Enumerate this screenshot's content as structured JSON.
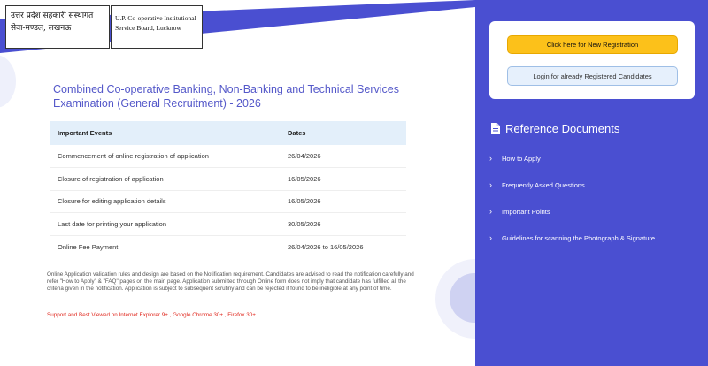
{
  "header": {
    "logo_hindi_line1": "उत्तर प्रदेश सहकारी संस्थागत",
    "logo_hindi_line2": "सेवा-मण्डल, लखनऊ",
    "logo_english_line1": "U.P. Co-operative Institutional",
    "logo_english_line2": "Service Board, Lucknow"
  },
  "main": {
    "title": "Combined Co-operative Banking, Non-Banking and Technical Services Examination (General Recruitment) - 2026",
    "table": {
      "headers": [
        "Important Events",
        "Dates"
      ],
      "rows": [
        [
          "Commencement of online registration of application",
          "26/04/2026"
        ],
        [
          "Closure of registration of application",
          "16/05/2026"
        ],
        [
          "Closure for editing application details",
          "16/05/2026"
        ],
        [
          "Last date for printing your application",
          "30/05/2026"
        ],
        [
          "Online Fee Payment",
          "26/04/2026 to 16/05/2026"
        ]
      ]
    },
    "notice": "Online Application validation rules and design are based on the Notification requirement. Candidates are advised to read the notification carefully and refer \"How to Apply\" & \"FAQ\" pages on the main page. Application submitted through Online form does not imply that candidate has fulfilled all the criteria given in the notification. Application is subject to subsequent scrutiny and can be rejected if found to be ineligible at any point of time.",
    "support": "Support and Best Viewed on Internet Explorer 9+ , Google Chrome 30+ , Firefox 30+"
  },
  "sidebar": {
    "new_registration_label": "Click here for New Registration",
    "login_label": "Login for already Registered Candidates",
    "reference_title": "Reference Documents",
    "items": [
      {
        "label": "How to Apply"
      },
      {
        "label": "Frequently Asked Questions"
      },
      {
        "label": "Important Points"
      },
      {
        "label": "Guidelines for scanning the Photograph & Signature"
      }
    ]
  },
  "colors": {
    "accent": "#4a4fd1",
    "title": "#5458c9",
    "primary_button": "#fcc11a",
    "warning_text": "#e0281e"
  },
  "icons": {
    "reference": "document-icon",
    "list_bullet": "chevron-right-icon"
  }
}
